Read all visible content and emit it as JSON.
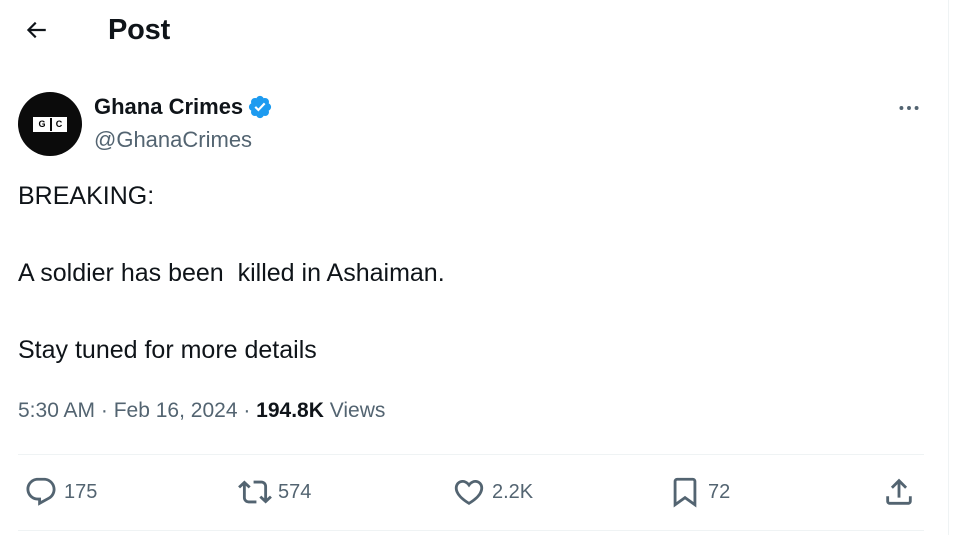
{
  "header": {
    "title": "Post"
  },
  "author": {
    "name": "Ghana Crimes",
    "handle": "@GhanaCrimes",
    "avatar_letters": [
      "G",
      "C"
    ],
    "verified_color": "#1d9bf0"
  },
  "tweet": {
    "lines": [
      "BREAKING:",
      "A soldier has been  killed in Ashaiman.",
      "Stay tuned for more details"
    ]
  },
  "meta": {
    "time": "5:30 AM",
    "separator": " · ",
    "date": "Feb 16, 2024",
    "views_count": "194.8K",
    "views_label": " Views"
  },
  "actions": {
    "replies": "175",
    "reposts": "574",
    "likes": "2.2K",
    "bookmarks": "72"
  },
  "colors": {
    "text": "#0f1419",
    "secondary": "#536471",
    "divider": "#eff3f4"
  },
  "icons": [
    "back-arrow-icon",
    "verified-badge-icon",
    "more-icon",
    "reply-icon",
    "retweet-icon",
    "like-icon",
    "bookmark-icon",
    "share-icon"
  ]
}
